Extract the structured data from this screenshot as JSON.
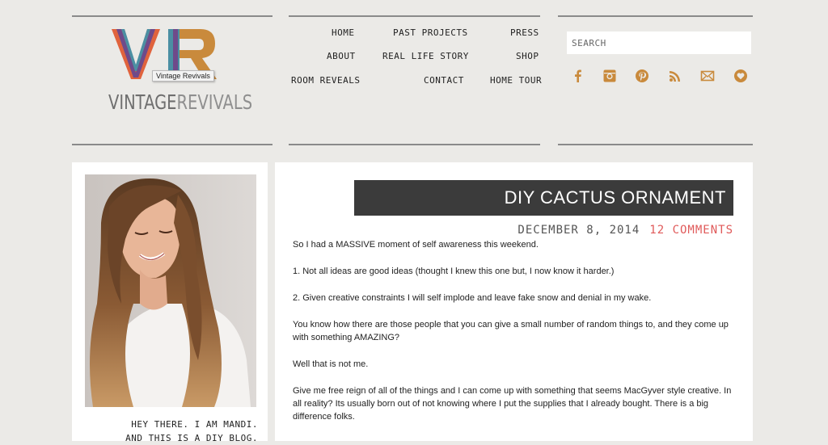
{
  "logo": {
    "text_vintage": "VINTAGE",
    "text_revivals": "REVIVALS",
    "tooltip": "Vintage Revivals"
  },
  "nav": {
    "home": "HOME",
    "past_projects": "PAST PROJECTS",
    "press": "PRESS",
    "about": "ABOUT",
    "real_life_story": "REAL LIFE STORY",
    "shop": "SHOP",
    "room_reveals": "ROOM REVEALS",
    "contact": "CONTACT",
    "home_tour": "HOME TOUR"
  },
  "search": {
    "placeholder": "SEARCH"
  },
  "social": {
    "color": "#c98a3c",
    "icons": [
      "facebook-icon",
      "instagram-icon",
      "pinterest-icon",
      "rss-icon",
      "email-icon",
      "heart-icon"
    ]
  },
  "sidebar": {
    "bio_line1": "HEY THERE. I AM MANDI.",
    "bio_line2": "AND THIS IS A DIY BLOG."
  },
  "post": {
    "title": "DIY CACTUS ORNAMENT",
    "date": "DECEMBER 8, 2014",
    "comments": "12 COMMENTS",
    "paragraphs": [
      "So I had a MASSIVE moment of self awareness this weekend.",
      "1.  Not all ideas are good ideas (thought I knew this one but, I now know it harder.)",
      "2.  Given creative constraints I will self implode and leave fake snow and denial in my wake.",
      "You know how there are those people that you can give a small number of random things to, and they come up with something AMAZING?",
      "Well that is not me.",
      "Give me free reign of all of the things and I can come up with something that seems MacGyver style creative. In all reality? Its usually born out of not knowing where I put the supplies that I already bought.  There is a big difference folks."
    ]
  }
}
